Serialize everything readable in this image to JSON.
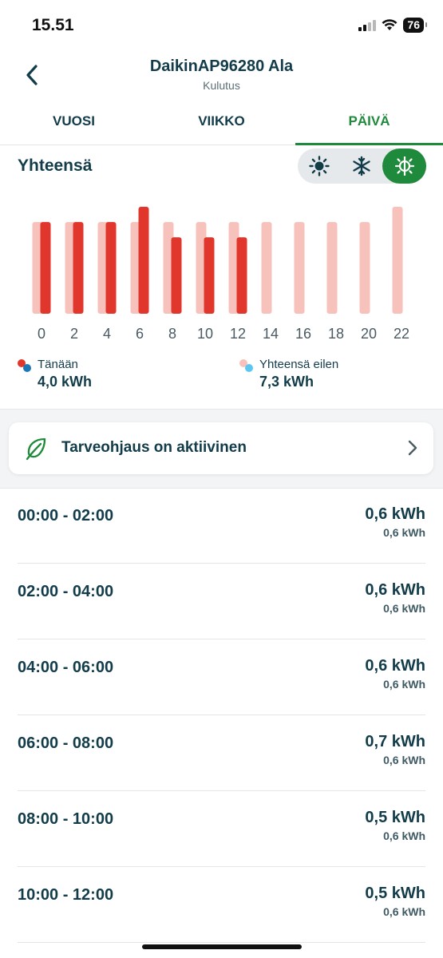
{
  "status_bar": {
    "time": "15.51",
    "battery": "76"
  },
  "header": {
    "title": "DaikinAP96280 Ala",
    "subtitle": "Kulutus"
  },
  "tabs": [
    {
      "label": "VUOSI",
      "active": false
    },
    {
      "label": "VIIKKO",
      "active": false
    },
    {
      "label": "PÄIVÄ",
      "active": true
    }
  ],
  "section_title": "Yhteensä",
  "mode_toggle": [
    "sun-icon",
    "snowflake-icon",
    "heat-cool-icon"
  ],
  "colors": {
    "accent": "#1f8a3c",
    "today": "#e0362c",
    "yesterday": "#f7c2bb",
    "text": "#123c4a"
  },
  "chart_data": {
    "type": "bar",
    "categories": [
      "0",
      "2",
      "4",
      "6",
      "8",
      "10",
      "12",
      "14",
      "16",
      "18",
      "20",
      "22"
    ],
    "series": [
      {
        "name": "Yhteensä eilen",
        "values": [
          0.6,
          0.6,
          0.6,
          0.6,
          0.6,
          0.6,
          0.6,
          0.6,
          0.6,
          0.6,
          0.6,
          0.7
        ]
      },
      {
        "name": "Tänään",
        "values": [
          0.6,
          0.6,
          0.6,
          0.7,
          0.5,
          0.5,
          0.5,
          null,
          null,
          null,
          null,
          null
        ]
      }
    ],
    "ylim": [
      0,
      0.7
    ]
  },
  "legend": {
    "today": {
      "label": "Tänään",
      "value": "4,0 kWh"
    },
    "yesterday": {
      "label": "Yhteensä eilen",
      "value": "7,3 kWh"
    }
  },
  "demand_card": {
    "label": "Tarveohjaus on aktiivinen"
  },
  "rows": [
    {
      "time": "00:00 - 02:00",
      "value": "0,6 kWh",
      "sub": "0,6 kWh"
    },
    {
      "time": "02:00 - 04:00",
      "value": "0,6 kWh",
      "sub": "0,6 kWh"
    },
    {
      "time": "04:00 - 06:00",
      "value": "0,6 kWh",
      "sub": "0,6 kWh"
    },
    {
      "time": "06:00 - 08:00",
      "value": "0,7 kWh",
      "sub": "0,6 kWh"
    },
    {
      "time": "08:00 - 10:00",
      "value": "0,5 kWh",
      "sub": "0,6 kWh"
    },
    {
      "time": "10:00 - 12:00",
      "value": "0,5 kWh",
      "sub": "0,6 kWh"
    }
  ]
}
